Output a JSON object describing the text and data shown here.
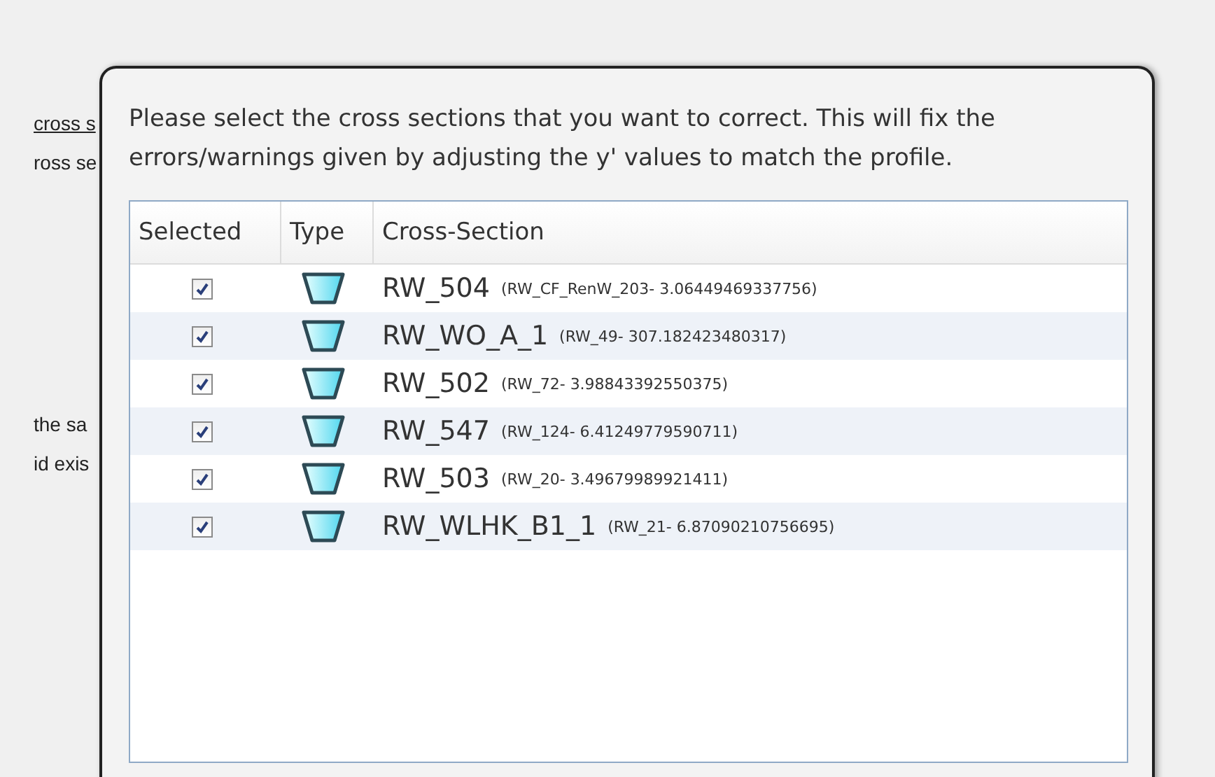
{
  "background_window": {
    "texts": [
      {
        "text": "cross s",
        "kind": "link"
      },
      {
        "text": "ross se",
        "kind": "plain"
      },
      {
        "text": "the sa",
        "kind": "plain"
      },
      {
        "text": "id exis",
        "kind": "plain"
      }
    ]
  },
  "dialog": {
    "message": "Please select the cross sections that you want to correct. This will fix the errors/warnings given by adjusting the y' values to match the profile.",
    "table": {
      "columns": [
        "Selected",
        "Type",
        "Cross-Section"
      ],
      "rows": [
        {
          "checked": true,
          "name": "RW_504",
          "detail": "(RW_CF_RenW_203- 3.06449469337756)"
        },
        {
          "checked": true,
          "name": "RW_WO_A_1",
          "detail": "(RW_49- 307.182423480317)"
        },
        {
          "checked": true,
          "name": "RW_502",
          "detail": "(RW_72- 3.98843392550375)"
        },
        {
          "checked": true,
          "name": "RW_547",
          "detail": "(RW_124- 6.41249779590711)"
        },
        {
          "checked": true,
          "name": "RW_503",
          "detail": "(RW_20- 3.49679989921411)"
        },
        {
          "checked": true,
          "name": "RW_WLHK_B1_1",
          "detail": "(RW_21- 6.87090210756695)"
        }
      ]
    }
  }
}
